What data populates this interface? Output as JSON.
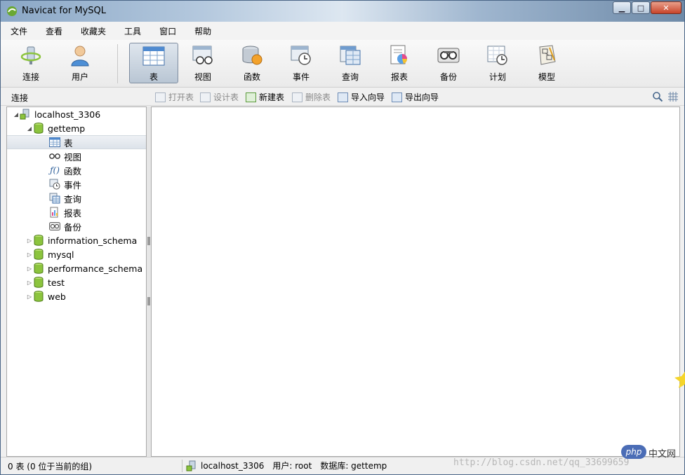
{
  "window": {
    "title": "Navicat for MySQL"
  },
  "menu": [
    "文件",
    "查看",
    "收藏夹",
    "工具",
    "窗口",
    "帮助"
  ],
  "toolbar": {
    "buttons": [
      {
        "label": "连接",
        "icon": "connect-icon"
      },
      {
        "label": "用户",
        "icon": "user-icon"
      },
      {
        "label": "表",
        "icon": "table-icon",
        "active": true
      },
      {
        "label": "视图",
        "icon": "view-icon"
      },
      {
        "label": "函数",
        "icon": "function-icon"
      },
      {
        "label": "事件",
        "icon": "event-icon"
      },
      {
        "label": "查询",
        "icon": "query-icon"
      },
      {
        "label": "报表",
        "icon": "report-icon"
      },
      {
        "label": "备份",
        "icon": "backup-icon"
      },
      {
        "label": "计划",
        "icon": "schedule-icon"
      },
      {
        "label": "模型",
        "icon": "model-icon"
      }
    ]
  },
  "subbar": {
    "connection_label": "连接",
    "actions": [
      {
        "label": "打开表",
        "enabled": false
      },
      {
        "label": "设计表",
        "enabled": false
      },
      {
        "label": "新建表",
        "enabled": true
      },
      {
        "label": "删除表",
        "enabled": false
      },
      {
        "label": "导入向导",
        "enabled": true
      },
      {
        "label": "导出向导",
        "enabled": true
      }
    ]
  },
  "tree": {
    "connection": "localhost_3306",
    "open_database": "gettemp",
    "object_types": [
      {
        "label": "表",
        "icon": "table-icon",
        "selected": true
      },
      {
        "label": "视图",
        "icon": "view-icon"
      },
      {
        "label": "函数",
        "icon": "function-icon"
      },
      {
        "label": "事件",
        "icon": "event-icon"
      },
      {
        "label": "查询",
        "icon": "query-icon"
      },
      {
        "label": "报表",
        "icon": "report-icon"
      },
      {
        "label": "备份",
        "icon": "backup-icon"
      }
    ],
    "databases": [
      "information_schema",
      "mysql",
      "performance_schema",
      "test",
      "web"
    ]
  },
  "status": {
    "count_text": "0 表 (0 位于当前的组)",
    "connection": "localhost_3306",
    "user": "用户: root",
    "database": "数据库: gettemp"
  },
  "overlays": {
    "watermark": "http://blog.csdn.net/qq_33699659",
    "php_badge": "php",
    "cn_badge": "中文网"
  },
  "colors": {
    "accent": "#4a6586",
    "db_icon": "#8cc43e",
    "selected_row": "#dde3ea"
  }
}
